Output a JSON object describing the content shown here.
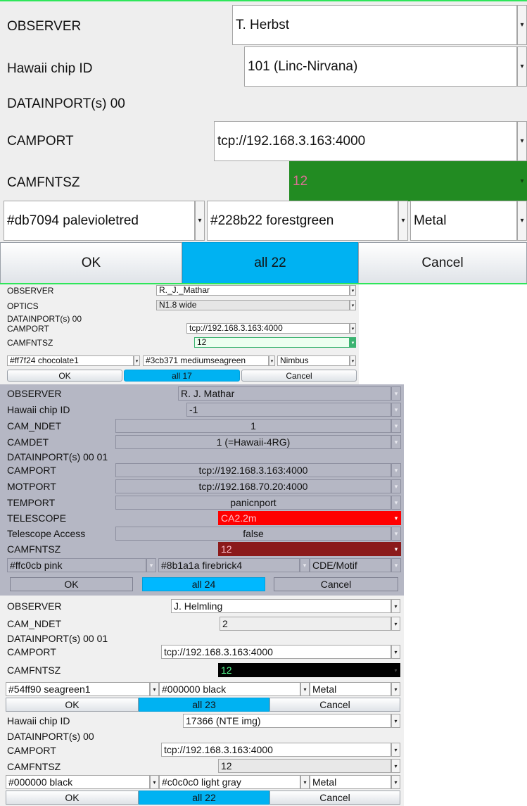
{
  "panel1": {
    "observer_label": "OBSERVER",
    "observer_value": "T. Herbst",
    "chip_label": "Hawaii chip ID",
    "chip_value": "101 (Linc-Nirvana)",
    "datainport_label": "DATAINPORT(s) 00",
    "camport_label": "CAMPORT",
    "camport_value": "tcp://192.168.3.163:4000",
    "camfntsz_label": "CAMFNTSZ",
    "camfntsz_value": "12",
    "fg_color": "#db7094 palevioletred",
    "bg_color": "#228b22 forestgreen",
    "laf": "Metal",
    "ok": "OK",
    "all": "all 22",
    "cancel": "Cancel",
    "accent_color": "#2e8b22"
  },
  "panel2": {
    "observer_label": "OBSERVER",
    "observer_value": "R._J._Mathar",
    "optics_label": "OPTICS",
    "optics_value": "N1.8 wide",
    "datainport_label": "DATAINPORT(s) 00",
    "camport_label": "CAMPORT",
    "camport_value": "tcp://192.168.3.163:4000",
    "camfntsz_label": "CAMFNTSZ",
    "camfntsz_value": "12",
    "fg_color": "#ff7f24 chocolate1",
    "bg_color": "#3cb371 mediumseagreen",
    "laf": "Nimbus",
    "ok": "OK",
    "all": "all 17",
    "cancel": "Cancel"
  },
  "panel3": {
    "observer_label": "OBSERVER",
    "observer_value": "R. J. Mathar",
    "chip_label": "Hawaii chip ID",
    "chip_value": "-1",
    "camndet_label": "CAM_NDET",
    "camndet_value": "1",
    "camdet_label": "CAMDET",
    "camdet_value": "1 (=Hawaii-4RG)",
    "datainport_label": "DATAINPORT(s) 00 01",
    "camport_label": "CAMPORT",
    "camport_value": "tcp://192.168.3.163:4000",
    "motport_label": "MOTPORT",
    "motport_value": "tcp://192.168.70.20:4000",
    "temport_label": "TEMPORT",
    "temport_value": "panicnport",
    "telescope_label": "TELESCOPE",
    "telescope_value": "CA2.2m",
    "access_label": "Telescope Access",
    "access_value": "false",
    "camfntsz_label": "CAMFNTSZ",
    "camfntsz_value": "12",
    "fg_color": "#ffc0cb pink",
    "bg_color": "#8b1a1a firebrick4",
    "laf": "CDE/Motif",
    "ok": "OK",
    "all": "all 24",
    "cancel": "Cancel"
  },
  "panel4": {
    "observer_label": "OBSERVER",
    "observer_value": "J. Helmling",
    "camndet_label": "CAM_NDET",
    "camndet_value": "2",
    "datainport_label": "DATAINPORT(s) 00 01",
    "camport_label": "CAMPORT",
    "camport_value": "tcp://192.168.3.163:4000",
    "camfntsz_label": "CAMFNTSZ",
    "camfntsz_value": "12",
    "fg_color": "#54ff90 seagreen1",
    "bg_color": "#000000 black",
    "laf": "Metal",
    "ok": "OK",
    "all": "all 23",
    "cancel": "Cancel"
  },
  "panel5": {
    "chip_label": "Hawaii chip ID",
    "chip_value": "17366 (NTE img)",
    "datainport_label": "DATAINPORT(s) 00",
    "camport_label": "CAMPORT",
    "camport_value": "tcp://192.168.3.163:4000",
    "camfntsz_label": "CAMFNTSZ",
    "camfntsz_value": "12",
    "fg_color": "#000000 black",
    "bg_color": "#c0c0c0 light gray",
    "laf": "Metal",
    "ok": "OK",
    "all": "all 22",
    "cancel": "Cancel"
  },
  "arrow_glyph": "▾"
}
